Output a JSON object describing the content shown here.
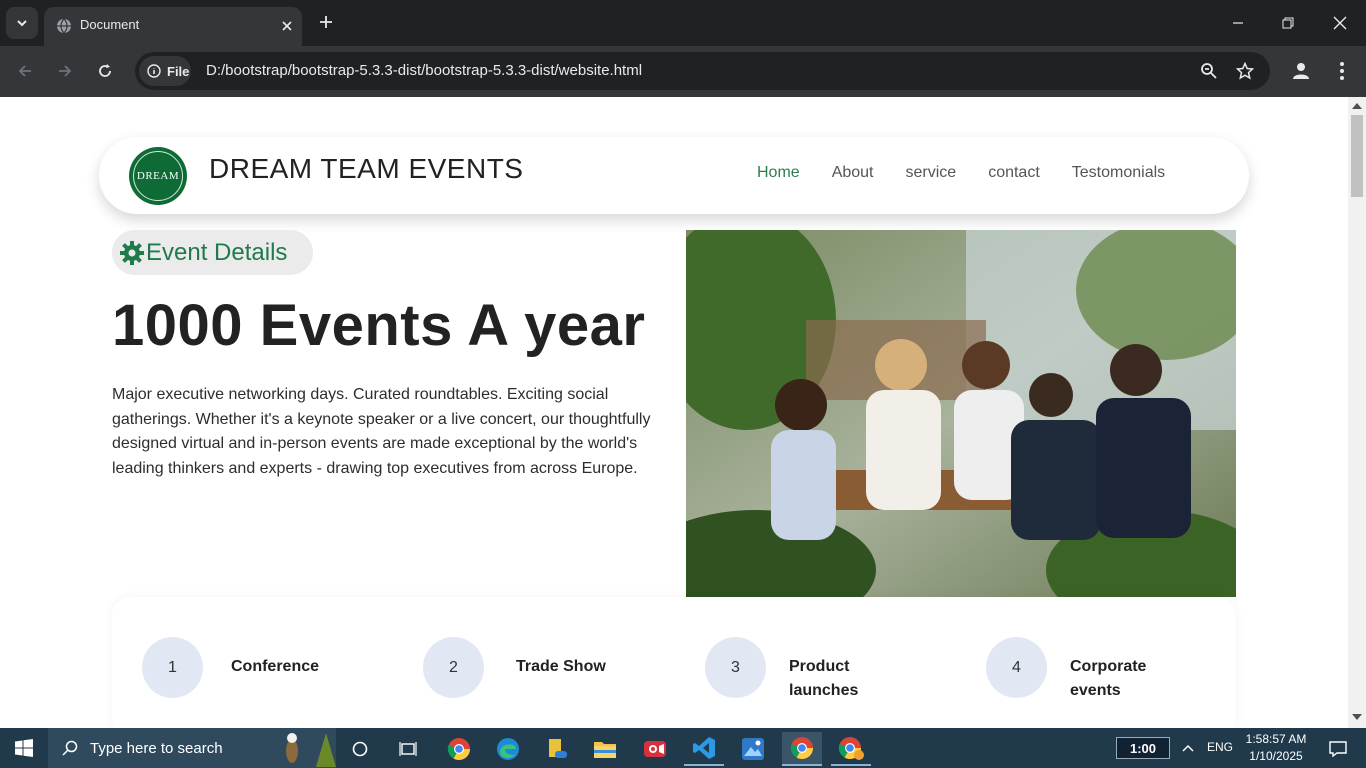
{
  "browser": {
    "tab_title": "Document",
    "url_chip": "File",
    "url": "D:/bootstrap/bootstrap-5.3.3-dist/bootstrap-5.3.3-dist/website.html"
  },
  "site": {
    "logo_text": "DREAM",
    "brand": "DREAM TEAM EVENTS",
    "nav": [
      {
        "label": "Home",
        "active": true
      },
      {
        "label": "About",
        "active": false
      },
      {
        "label": "service",
        "active": false
      },
      {
        "label": "contact",
        "active": false
      },
      {
        "label": "Testomonials",
        "active": false
      }
    ],
    "accent_color": "#1f7a4c",
    "badge": "Event Details",
    "headline": "1000 Events A year",
    "description": "Major executive networking days. Curated roundtables. Exciting social gatherings. Whether it's a keynote speaker or a live concert, our thoughtfully designed virtual and in-person events are made exceptional by the world's leading thinkers and experts - drawing top executives from across Europe.",
    "cards": [
      {
        "num": "1",
        "label": "Conference"
      },
      {
        "num": "2",
        "label": "Trade Show"
      },
      {
        "num": "3",
        "label": "Product launches"
      },
      {
        "num": "4",
        "label": "Corporate events"
      }
    ]
  },
  "taskbar": {
    "search_placeholder": "Type here to search",
    "tray_badge": "1:00",
    "language": "ENG",
    "time": "1:58:57 AM",
    "date": "1/10/2025"
  }
}
